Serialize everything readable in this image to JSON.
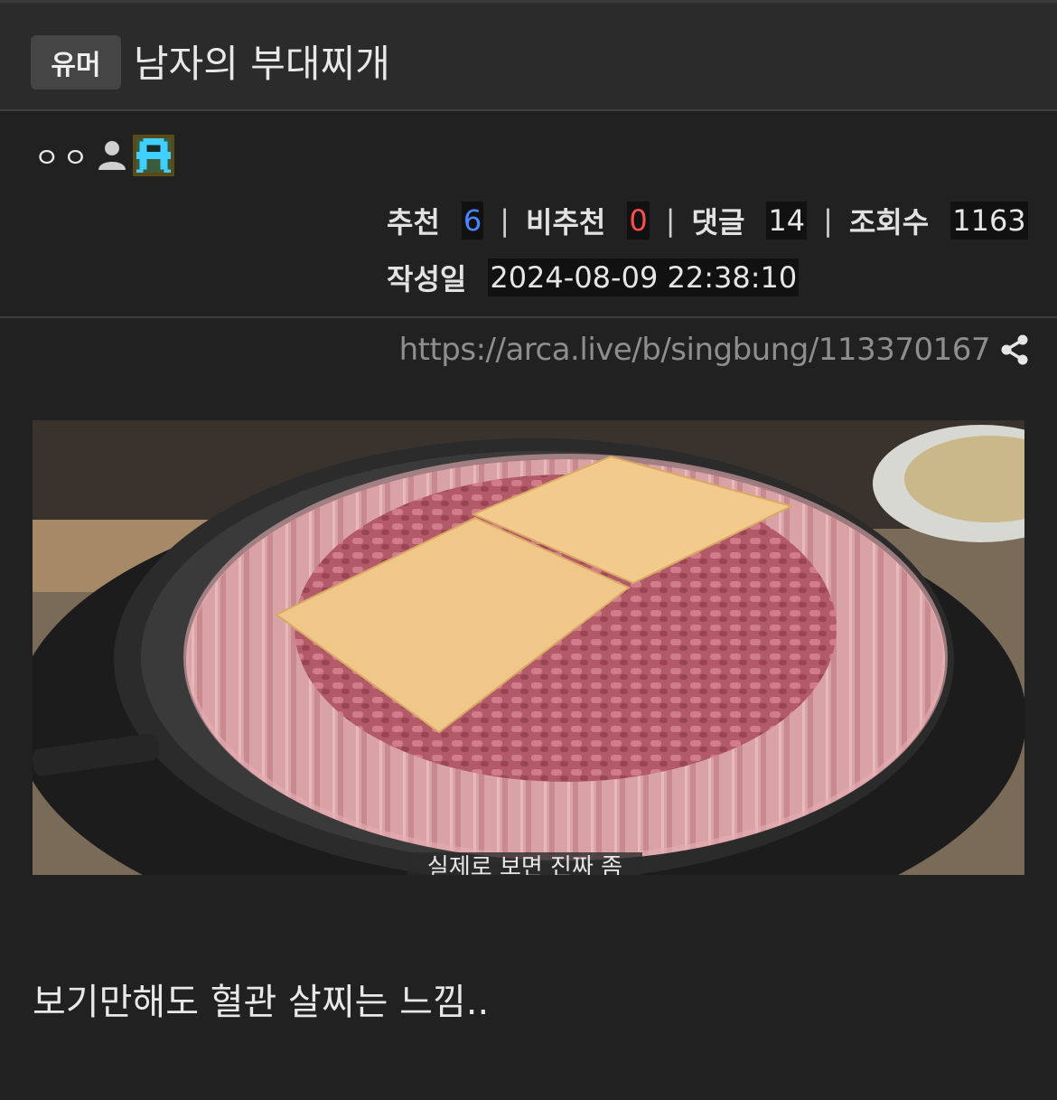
{
  "post": {
    "category": "유머",
    "title": "남자의 부대찌개",
    "author": "ㅇㅇ",
    "stats": {
      "upvote_label": "추천",
      "upvote_value": "6",
      "downvote_label": "비추천",
      "downvote_value": "0",
      "comments_label": "댓글",
      "comments_value": "14",
      "views_label": "조회수",
      "views_value": "1163",
      "separator": "|"
    },
    "date_label": "작성일",
    "date_value": "2024-08-09 22:38:10",
    "url": "https://arca.live/b/singbung/113370167",
    "image": {
      "caption": "실제로 보면 진짜 좀"
    },
    "body": "보기만해도 혈관 살찌는 느낌.."
  },
  "icons": {
    "author": "person-icon",
    "badge": "pixel-character-icon",
    "share": "share-icon"
  },
  "colors": {
    "background": "#212121",
    "header": "#2b2b2b",
    "upvote": "#4a84ff",
    "downvote": "#ff4d4d",
    "url": "#8e8e8e"
  }
}
